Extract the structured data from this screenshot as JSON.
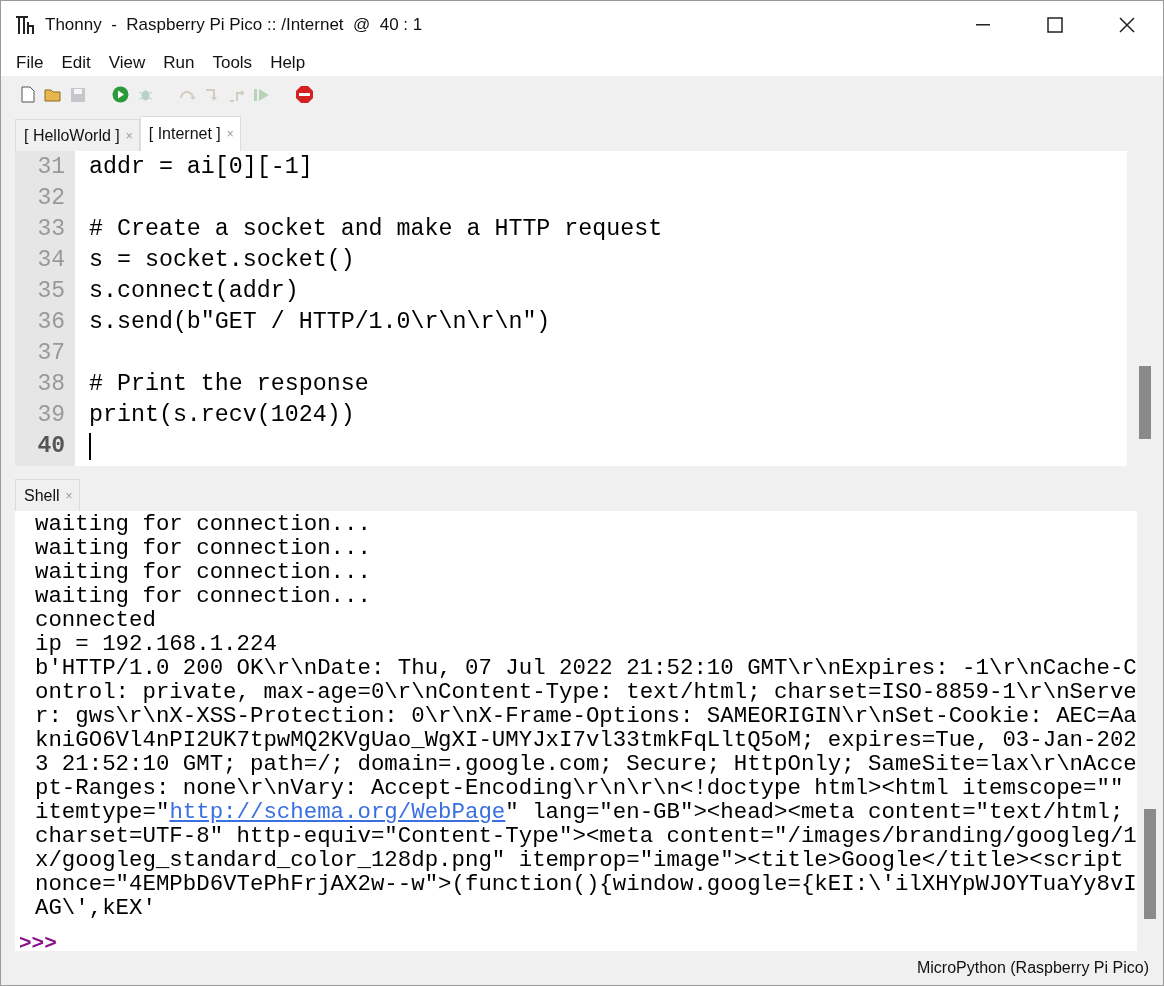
{
  "window": {
    "title": "Thonny  -  Raspberry Pi Pico :: /Internet  @  40 : 1"
  },
  "menu": [
    "File",
    "Edit",
    "View",
    "Run",
    "Tools",
    "Help"
  ],
  "toolbar": [
    {
      "kind": "new",
      "disabled": false
    },
    {
      "kind": "open",
      "disabled": false
    },
    {
      "kind": "save",
      "disabled": true
    },
    {
      "kind": "run",
      "disabled": false
    },
    {
      "kind": "debug",
      "disabled": true
    },
    {
      "kind": "step-over",
      "disabled": true
    },
    {
      "kind": "step-into",
      "disabled": true
    },
    {
      "kind": "step-out",
      "disabled": true
    },
    {
      "kind": "resume",
      "disabled": true
    },
    {
      "kind": "stop",
      "disabled": false
    }
  ],
  "editor_tabs": [
    {
      "label": "[ HelloWorld ]",
      "close": "×",
      "selected": false
    },
    {
      "label": "[ Internet ]",
      "close": "×",
      "selected": true
    }
  ],
  "editor": {
    "lines": [
      {
        "number": "31",
        "code": "addr = ai[0][-1]",
        "current": false
      },
      {
        "number": "32",
        "current": false
      },
      {
        "number": "33",
        "code": "# Create a socket and make a HTTP request",
        "current": false
      },
      {
        "number": "34",
        "code": "s = socket.socket()",
        "current": false
      },
      {
        "number": "35",
        "code": "s.connect(addr)",
        "current": false
      },
      {
        "number": "36",
        "code": "s.send(b\"GET / HTTP/1.0\\r\\n\\r\\n\")",
        "current": false
      },
      {
        "number": "37",
        "current": false
      },
      {
        "number": "38",
        "code": "# Print the response",
        "current": false
      },
      {
        "number": "39",
        "code": "print(s.recv(1024))",
        "current": false
      },
      {
        "number": "40",
        "current": true
      }
    ]
  },
  "shell": {
    "tab": {
      "label": "Shell",
      "close": "×"
    },
    "lines": [
      {
        "kind": "plain",
        "text": "waiting for connection..."
      },
      {
        "kind": "plain",
        "text": "waiting for connection..."
      },
      {
        "kind": "plain",
        "text": "waiting for connection..."
      },
      {
        "kind": "plain",
        "text": "waiting for connection..."
      },
      {
        "kind": "plain",
        "text": "connected"
      },
      {
        "kind": "plain",
        "text": "ip = 192.168.1.224"
      },
      {
        "kind": "plain",
        "text": "b'HTTP/1.0 200 OK\\r\\nDate: Thu, 07 Jul 2022 21:52:10 GMT\\r\\nExpires: -1\\r\\nCache-C"
      },
      {
        "kind": "plain",
        "text": "ontrol: private, max-age=0\\r\\nContent-Type: text/html; charset=ISO-8859-1\\r\\nServe"
      },
      {
        "kind": "plain",
        "text": "r: gws\\r\\nX-XSS-Protection: 0\\r\\nX-Frame-Options: SAMEORIGIN\\r\\nSet-Cookie: AEC=Aa"
      },
      {
        "kind": "plain",
        "text": "kniGO6Vl4nPI2UK7tpwMQ2KVgUao_WgXI-UMYJxI7vl33tmkFqLltQ5oM; expires=Tue, 03-Jan-202"
      },
      {
        "kind": "plain",
        "text": "3 21:52:10 GMT; path=/; domain=.google.com; Secure; HttpOnly; SameSite=lax\\r\\nAcce"
      },
      {
        "kind": "plain",
        "text": "pt-Ranges: none\\r\\nVary: Accept-Encoding\\r\\n\\r\\n<!doctype html><html itemscope=\"\""
      },
      {
        "kind": "linked",
        "before": "itemtype=\"",
        "link": "http://schema.org/WebPage",
        "after": "\" lang=\"en-GB\"><head><meta content=\"text/html;"
      },
      {
        "kind": "plain",
        "text": "charset=UTF-8\" http-equiv=\"Content-Type\"><meta content=\"/images/branding/googleg/1"
      },
      {
        "kind": "plain",
        "text": "x/googleg_standard_color_128dp.png\" itemprop=\"image\"><title>Google</title><script"
      },
      {
        "kind": "plain",
        "text": "nonce=\"4EMPbD6VTePhFrjAX2w--w\">(function(){window.google={kEI:\\'ilXHYpWJOYTuaYy8vI"
      },
      {
        "kind": "plain",
        "text": "AG\\',kEX'"
      }
    ],
    "prompt": ">>>"
  },
  "status_bar": {
    "interpreter": "MicroPython (Raspberry Pi Pico)"
  }
}
